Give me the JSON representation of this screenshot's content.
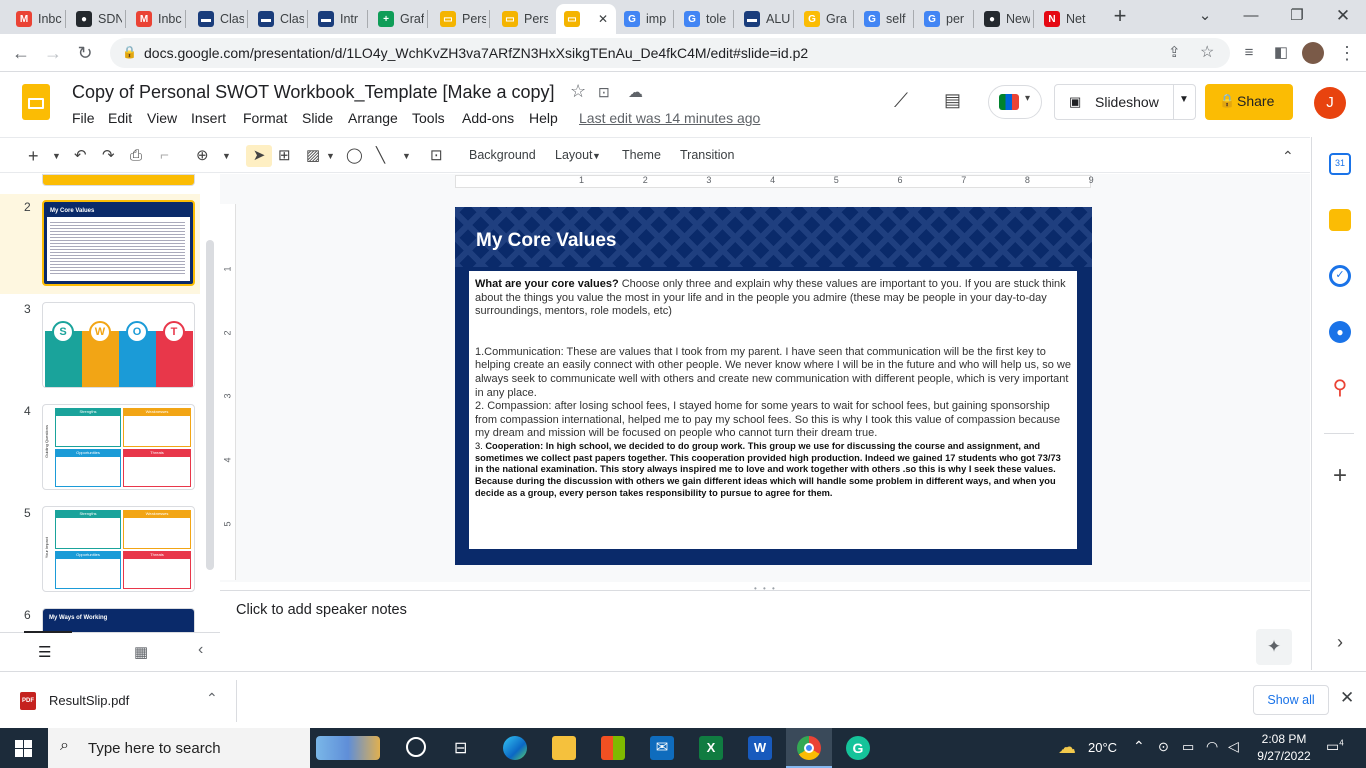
{
  "browser": {
    "tabs": [
      {
        "label": "Inbc",
        "icon": "gmail-icon",
        "color": "#ea4335",
        "glyph": "M"
      },
      {
        "label": "SDN",
        "icon": "github-icon",
        "color": "#24292e",
        "glyph": "●"
      },
      {
        "label": "Inbc",
        "icon": "gmail-icon",
        "color": "#ea4335",
        "glyph": "M"
      },
      {
        "label": "Clas",
        "icon": "classroom-icon",
        "color": "#1a3d7c",
        "glyph": "▬"
      },
      {
        "label": "Clas",
        "icon": "classroom-icon",
        "color": "#1a3d7c",
        "glyph": "▬"
      },
      {
        "label": "Intr",
        "icon": "classroom-icon",
        "color": "#1a3d7c",
        "glyph": "▬"
      },
      {
        "label": "Graf",
        "icon": "sheets-icon",
        "color": "#0f9d58",
        "glyph": "+"
      },
      {
        "label": "Pers",
        "icon": "slides-icon",
        "color": "#f4b400",
        "glyph": "▭"
      },
      {
        "label": "Pers",
        "icon": "slides-icon",
        "color": "#f4b400",
        "glyph": "▭"
      },
      {
        "label": "",
        "icon": "slides-icon",
        "color": "#f4b400",
        "glyph": "▭"
      },
      {
        "label": "imp",
        "icon": "google-icon",
        "color": "#4285f4",
        "glyph": "G"
      },
      {
        "label": "tole",
        "icon": "google-icon",
        "color": "#4285f4",
        "glyph": "G"
      },
      {
        "label": "ALU",
        "icon": "classroom-icon",
        "color": "#1a3d7c",
        "glyph": "▬"
      },
      {
        "label": "Gra",
        "icon": "google-drive-icon",
        "color": "#fbbc04",
        "glyph": "G"
      },
      {
        "label": "self",
        "icon": "google-icon",
        "color": "#4285f4",
        "glyph": "G"
      },
      {
        "label": "per",
        "icon": "google-icon",
        "color": "#4285f4",
        "glyph": "G"
      },
      {
        "label": "New",
        "icon": "github-icon",
        "color": "#24292e",
        "glyph": "●"
      },
      {
        "label": "Net",
        "icon": "netflix-icon",
        "color": "#e50914",
        "glyph": "N"
      }
    ],
    "new_tab": "+",
    "url": "docs.google.com/presentation/d/1LO4y_WchKvZH3va7ARfZN3HxXsikgTEnAu_De4fkC4M/edit#slide=id.p2"
  },
  "docs": {
    "title": "Copy of Personal SWOT Workbook_Template [Make a copy]",
    "menus": [
      "File",
      "Edit",
      "View",
      "Insert",
      "Format",
      "Slide",
      "Arrange",
      "Tools",
      "Add-ons",
      "Help"
    ],
    "last_edit": "Last edit was 14 minutes ago",
    "slideshow": "Slideshow",
    "share": "Share",
    "avatar_letter": "J"
  },
  "toolbar": {
    "background": "Background",
    "layout": "Layout",
    "theme": "Theme",
    "transition": "Transition"
  },
  "ruler": {
    "marks": [
      "1",
      "2",
      "3",
      "4",
      "5",
      "6",
      "7",
      "8",
      "9"
    ],
    "vmarks": [
      "1",
      "2",
      "3",
      "4",
      "5"
    ]
  },
  "filmstrip": {
    "slides": [
      {
        "num": "2",
        "title": "My Core Values"
      },
      {
        "num": "3",
        "letters": [
          "S",
          "W",
          "O",
          "T"
        ]
      },
      {
        "num": "4",
        "heads": [
          "Strengths",
          "Weaknesses",
          "Opportunities",
          "Threats"
        ],
        "side": "Guiding Questions"
      },
      {
        "num": "5",
        "heads": [
          "Strengths",
          "Weaknesses",
          "Opportunities",
          "Threats"
        ],
        "side": "Your Impact"
      },
      {
        "num": "6",
        "title": "My Ways of Working"
      }
    ]
  },
  "slide": {
    "title": "My Core Values",
    "question_bold": "What are your core values?",
    "question_rest": " Choose only three and explain why these values are important to you. If you are stuck think about the things you value the most in your life and in the people you admire (these may be people in your day-to-day surroundings, mentors, role models, etc)",
    "p1": "1.Communication: These are values that I took from my parent. I have seen that communication will be the first key to helping create an easily connect with other people. We never know where I will be in the future and who will help us, so we always seek to communicate well with others and create new communication with different people, which is very important in any place.",
    "p2": "2.  Compassion: after losing school fees, I stayed home for some years to wait for school fees, but gaining sponsorship from compassion international, helped me to pay my school fees. So this is why I took this value of compassion because my dream and mission will be focused on people who cannot turn their dream true.",
    "p3_num": "3. ",
    "p3": "Cooperation: In high school, we decided to do group work. This group we use for discussing the course and assignment, and sometimes we collect past papers together. This cooperation provided high production. Indeed we gained 17 students who got 73/73 in the national examination. This story always inspired me to love and work together with others .so this is why I seek these values. Because during the discussion with others we gain different ideas which will handle some problem in different ways, and when you decide as a group, every person takes responsibility to pursue to agree for them."
  },
  "notes_placeholder": "Click to add speaker notes",
  "download": {
    "file": "ResultSlip.pdf",
    "badge": "PDF",
    "show_all": "Show all"
  },
  "taskbar": {
    "search_placeholder": "Type here to search",
    "weather": "20°C",
    "time": "2:08 PM",
    "date": "9/27/2022",
    "notif_count": "4"
  },
  "colors": {
    "slide_navy": "#0a2a6a",
    "share_yellow": "#fbbc04",
    "accent_blue": "#1a73e8"
  }
}
